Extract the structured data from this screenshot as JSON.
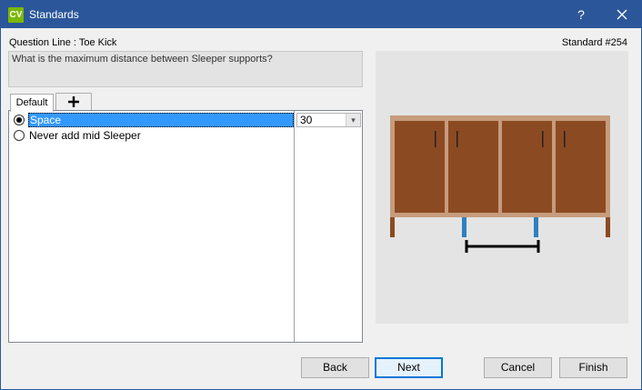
{
  "window": {
    "logo": "CV",
    "title": "Standards",
    "help": "?"
  },
  "header": {
    "question_line": "Question Line : Toe Kick",
    "standard_number": "Standard #254",
    "question": "What is the maximum distance between Sleeper supports?"
  },
  "tabs": {
    "default_label": "Default",
    "add_icon": "plus-icon"
  },
  "options": [
    {
      "label": "Space",
      "selected": true,
      "value": "30"
    },
    {
      "label": "Never add mid Sleeper",
      "selected": false
    }
  ],
  "buttons": {
    "back": "Back",
    "next": "Next",
    "cancel": "Cancel",
    "finish": "Finish"
  },
  "colors": {
    "titlebar": "#2b579a",
    "logo": "#7ab800",
    "cabinet_frame": "#c69c7c",
    "cabinet_door": "#8b4a22",
    "leg": "#8b4a22",
    "sleeper_support": "#2f7fc1",
    "selection": "#3399ff"
  }
}
